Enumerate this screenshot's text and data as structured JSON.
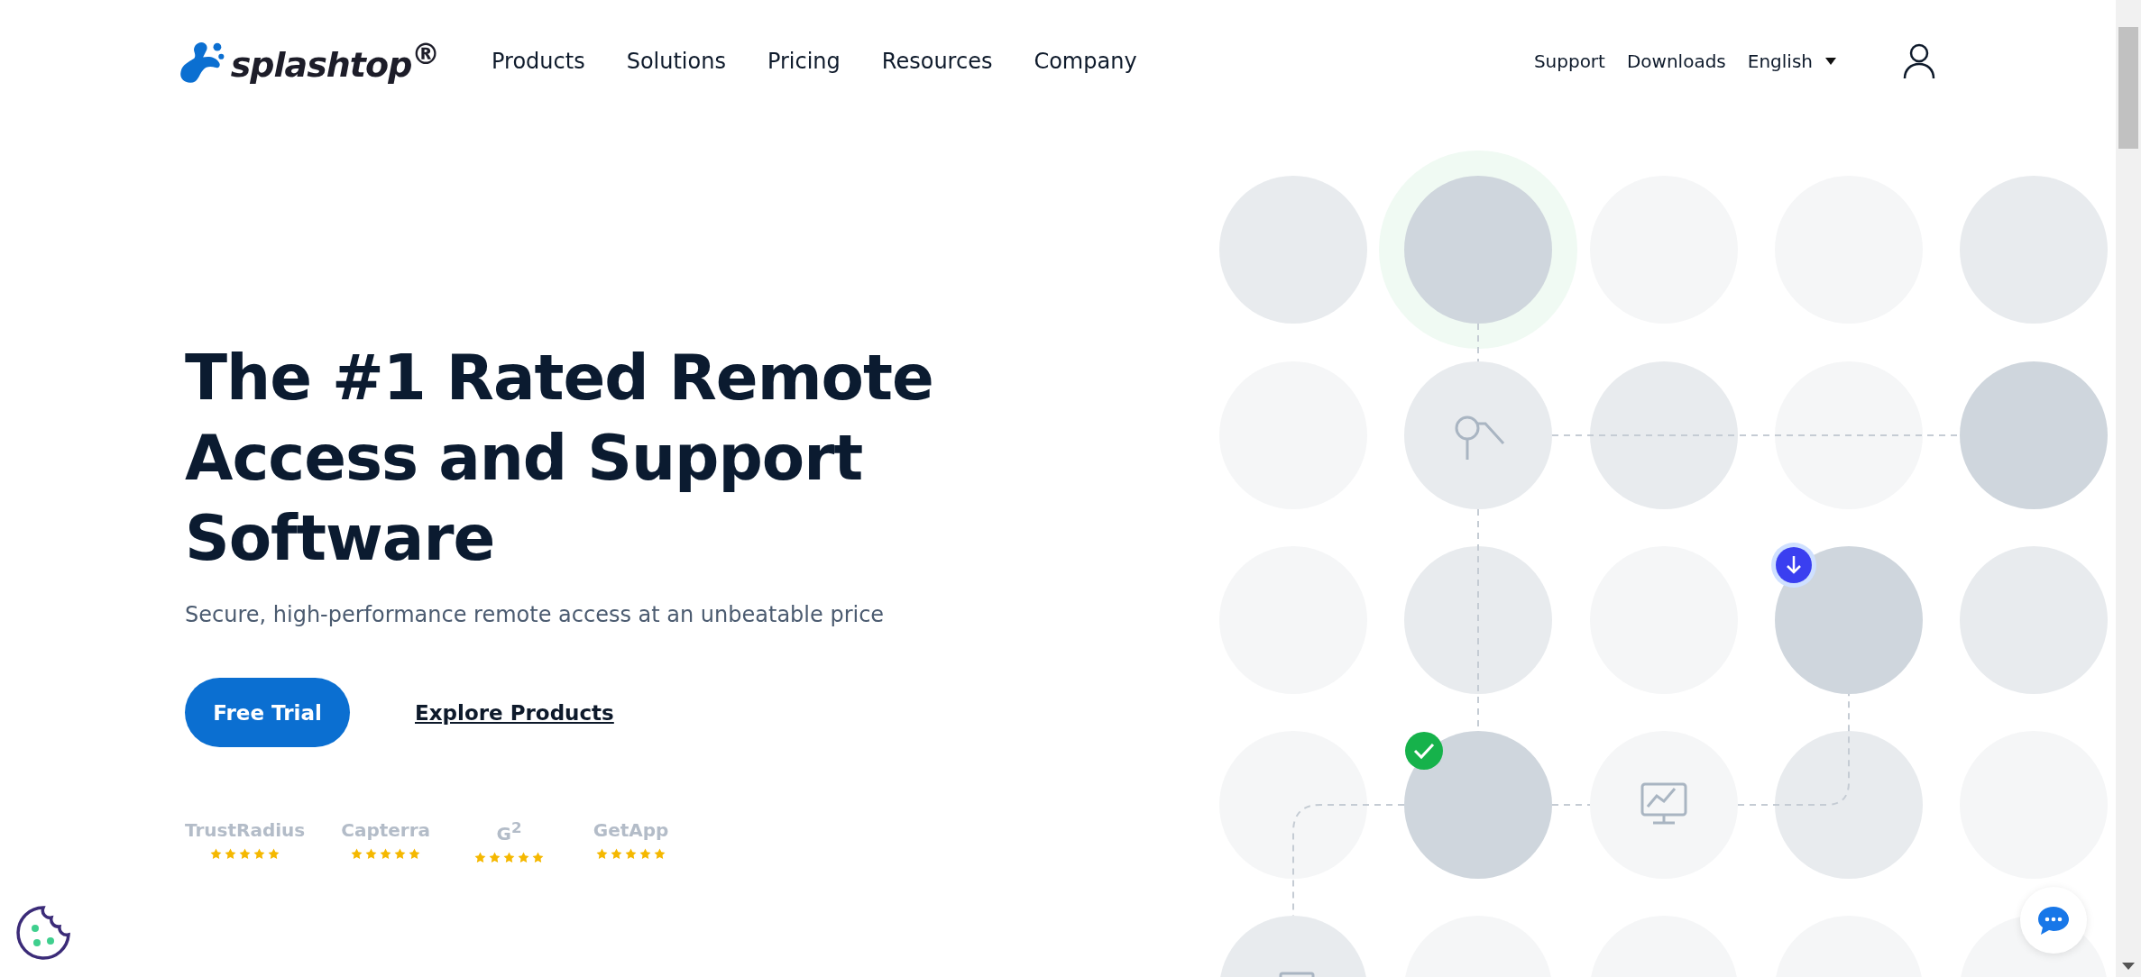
{
  "header": {
    "logo": "splashtop$^{®}$",
    "nav": [
      "Products",
      "Solutions",
      "Pricing",
      "Resources",
      "Company"
    ],
    "links": [
      "Support",
      "Downloads"
    ],
    "language": "English"
  },
  "hero": {
    "headline": [
      "The #1 Rated Remote",
      "Access and Support",
      "Software"
    ],
    "subtitle": "Secure, high-performance remote access at an unbeatable price",
    "primary_button": "Free Trial",
    "secondary_link": "Explore Products",
    "ratings": [
      {
        "label": "TrustRadius",
        "stars": 5
      },
      {
        "label": "Capterra",
        "stars": 5
      },
      {
        "label": "G$^{2}$",
        "stars": 5
      },
      {
        "label": "GetApp",
        "stars": 5
      }
    ]
  }
}
